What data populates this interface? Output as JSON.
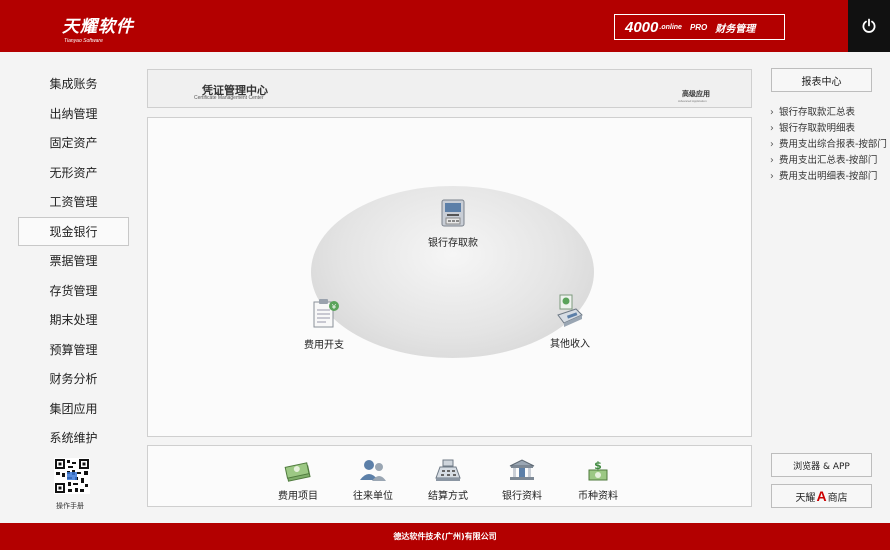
{
  "header": {
    "logo_cn": "天耀软件",
    "logo_en": "Tianyao Software",
    "product_number": "4000",
    "product_suffix": ".online",
    "product_edition": "PRO",
    "product_name": "财务管理",
    "power_icon": "power-icon"
  },
  "nav": {
    "items": [
      {
        "label": "集成账务"
      },
      {
        "label": "出纳管理"
      },
      {
        "label": "固定资产"
      },
      {
        "label": "无形资产"
      },
      {
        "label": "工资管理"
      },
      {
        "label": "现金银行",
        "active": true
      },
      {
        "label": "票据管理"
      },
      {
        "label": "存货管理"
      },
      {
        "label": "期末处理"
      },
      {
        "label": "预算管理"
      },
      {
        "label": "财务分析"
      },
      {
        "label": "集团应用"
      },
      {
        "label": "系统维护"
      }
    ],
    "manual_label": "操作手册",
    "qr_icon": "qr-code-icon"
  },
  "title_panel": {
    "title_cn": "凭证管理中心",
    "title_en": "Certificate Management Center",
    "advanced_cn": "高级应用",
    "advanced_en": "Advanced Application"
  },
  "diagram": {
    "nodes": [
      {
        "label": "银行存取款",
        "icon": "bank-deposit-icon"
      },
      {
        "label": "费用开支",
        "icon": "expense-icon"
      },
      {
        "label": "其他收入",
        "icon": "other-income-icon"
      }
    ]
  },
  "toolbar": {
    "items": [
      {
        "label": "费用项目",
        "icon": "money-stack-icon"
      },
      {
        "label": "往来单位",
        "icon": "contacts-icon"
      },
      {
        "label": "结算方式",
        "icon": "cash-register-icon"
      },
      {
        "label": "银行资料",
        "icon": "bank-building-icon"
      },
      {
        "label": "币种资料",
        "icon": "currency-icon"
      }
    ]
  },
  "right_panel": {
    "report_center_label": "报表中心",
    "reports": [
      {
        "label": "银行存取款汇总表"
      },
      {
        "label": "银行存取款明细表"
      },
      {
        "label": "费用支出综合报表-按部门"
      },
      {
        "label": "费用支出汇总表-按部门"
      },
      {
        "label": "费用支出明细表-按部门"
      }
    ],
    "browser_label": "浏览器 & APP",
    "store_prefix": "天耀",
    "store_letter": "A",
    "store_suffix": "商店"
  },
  "footer": {
    "company": "德达软件技术(广州)有限公司"
  },
  "colors": {
    "brand_red": "#b30000",
    "header_dark": "#111111",
    "panel_border": "#cfcfcf"
  }
}
